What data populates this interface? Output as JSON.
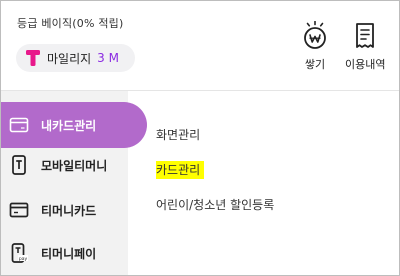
{
  "header": {
    "grade_text": "등급 베이직(0% 적립)",
    "mileage_label": "마일리지",
    "mileage_value": "3 M"
  },
  "actions": {
    "save_label": "쌓기",
    "history_label": "이용내역"
  },
  "sidebar": {
    "items": [
      {
        "label": "내카드관리",
        "icon": "card-icon"
      },
      {
        "label": "모바일티머니",
        "icon": "mobile-tmoney-icon"
      },
      {
        "label": "티머니카드",
        "icon": "card-icon"
      },
      {
        "label": "티머니페이",
        "icon": "pay-icon"
      }
    ],
    "active_index": 0
  },
  "submenu": {
    "items": [
      {
        "label": "화면관리"
      },
      {
        "label": "카드관리",
        "highlighted": true
      },
      {
        "label": "어린이/청소년 할인등록"
      }
    ]
  },
  "colors": {
    "accent": "#b26acb",
    "mileage_value": "#8b2be2",
    "highlight": "#ffff00",
    "sidebar_bg": "#f2f2f2"
  }
}
